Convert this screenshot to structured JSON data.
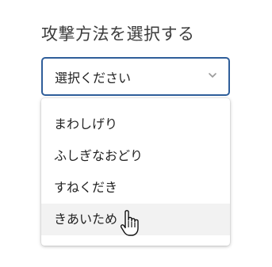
{
  "field": {
    "label": "攻撃方法を選択する",
    "select_value": "選択ください",
    "chevron_icon": "chevron-down-icon"
  },
  "menu": {
    "options": [
      {
        "label": "まわしげり"
      },
      {
        "label": "ふしぎなおどり"
      },
      {
        "label": "すねくだき"
      },
      {
        "label": "きあいため"
      }
    ],
    "hovered_index": 3
  },
  "cursor": {
    "icon": "hand-pointer-icon"
  },
  "colors": {
    "focus_border": "#2f5e9a",
    "hover_bg": "#f2f2f2",
    "text": "#222222"
  }
}
